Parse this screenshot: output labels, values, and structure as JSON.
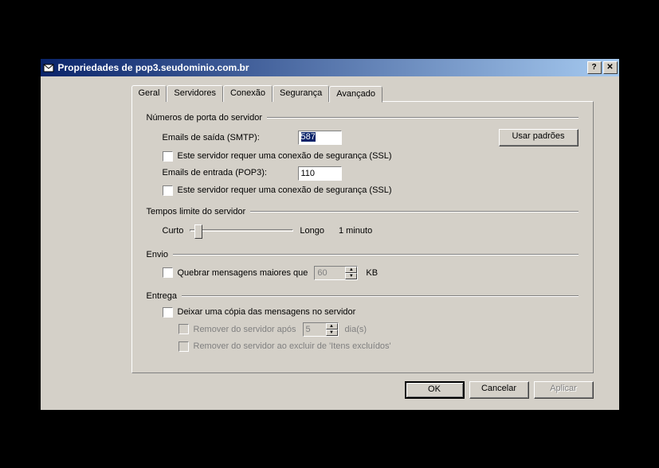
{
  "titlebar": {
    "title": "Propriedades de pop3.seudominio.com.br"
  },
  "tabs": {
    "items": [
      "Geral",
      "Servidores",
      "Conexão",
      "Segurança",
      "Avançado"
    ],
    "active": 4
  },
  "groups": {
    "ports": {
      "title": "Números de porta do servidor",
      "smtp_label": "Emails de saída (SMTP):",
      "smtp_value": "587",
      "defaults_btn": "Usar padrões",
      "smtp_ssl": "Este servidor requer uma conexão de segurança (SSL)",
      "pop_label": "Emails de entrada (POP3):",
      "pop_value": "110",
      "pop_ssl": "Este servidor requer uma conexão de segurança (SSL)"
    },
    "timeout": {
      "title": "Tempos limite do servidor",
      "short": "Curto",
      "long": "Longo",
      "value": "1 minuto"
    },
    "sending": {
      "title": "Envio",
      "break_label": "Quebrar mensagens maiores que",
      "break_value": "60",
      "kb": "KB"
    },
    "delivery": {
      "title": "Entrega",
      "leave_copy": "Deixar uma cópia das mensagens no servidor",
      "remove_after_label": "Remover do servidor após",
      "remove_after_value": "5",
      "days": "dia(s)",
      "remove_deleted": "Remover do servidor ao excluir de 'Itens excluídos'"
    }
  },
  "buttons": {
    "ok": "OK",
    "cancel": "Cancelar",
    "apply": "Aplicar"
  }
}
